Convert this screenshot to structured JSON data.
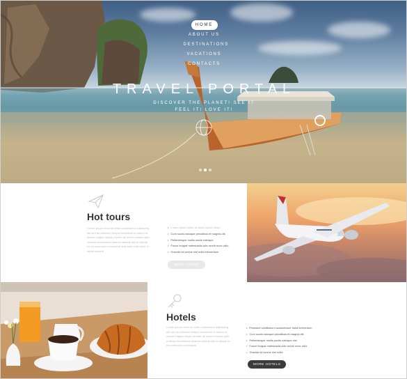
{
  "nav": {
    "items": [
      "HOME",
      "ABOUT US",
      "DESTINATIONS",
      "VACATIONS",
      "CONTACTS"
    ],
    "active_index": 0
  },
  "hero": {
    "title": "TRAVEL PORTAL",
    "subtitle_line1": "DISCOVER THE PLANET! SEE IT",
    "subtitle_line2": "FEEL IT! LOVE IT!",
    "slides": 3,
    "active_slide": 2
  },
  "hot_tours": {
    "heading": "Hot tours",
    "paragraph": "Lorem ipsum dolor sit amet consectetur adipiscing elit sed do eiusmod tempor incididunt ut labore et dolore magna aliqua ut enim ad minim veniam quis nostrud exercitation ullamco laboris nisi ut aliquip ex ea commodo consequat duis aute irure dolor in reprehenderit",
    "bullets": [
      "Lorem ipsum dolor sit amet conse ctetur",
      "Cum sociis natoque penatibus et magnis dis",
      "Pellentesque mollis sociis natoque",
      "Fusce feugiat malesuada odio morbi nunc odio",
      "Gravida at cursus nisl nulla elementum"
    ],
    "button": "MORE TOURS"
  },
  "hotels": {
    "heading": "Hotels",
    "paragraph": "Lorem ipsum dolor sit amet consectetur adipiscing elit sed do eiusmod tempor incididunt ut labore et dolore magna aliqua ut enim ad minim veniam quis nostrud exercitation ullamco laboris nisi ut aliquip ex ea commodo consequat",
    "bullets": [
      "Praesent vestibulum consectetuer nulla fermentum",
      "Cum sociis natoque penatibus et magnis dis",
      "Pellentesque mollis sociis natoque nisi",
      "Fusce feugiat malesuada odio morbi nunc odio",
      "Gravida at cursus nisl nulla"
    ],
    "button": "MORE HOTELS"
  },
  "icons": {
    "tours": "paper-plane-icon",
    "hotels": "key-icon"
  }
}
